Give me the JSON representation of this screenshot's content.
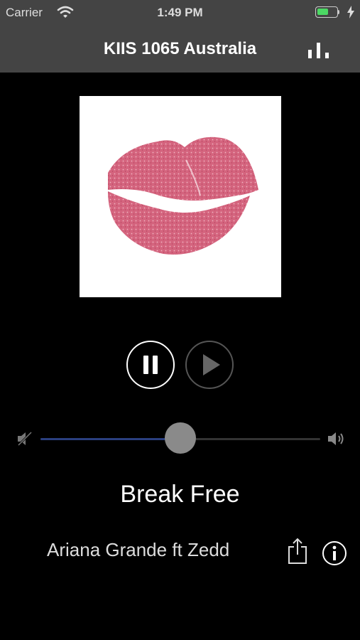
{
  "status_bar": {
    "carrier": "Carrier",
    "time": "1:49 PM",
    "battery_level": 0.6,
    "battery_color": "#4cd964"
  },
  "nav": {
    "title": "KIIS 1065 Australia",
    "equalizer_icon": "equalizer-icon"
  },
  "player": {
    "artwork_icon": "lips-icon",
    "pause_icon": "pause-icon",
    "play_icon": "play-icon",
    "volume_level": 0.5,
    "volume_fill_color": "#2a3f7f"
  },
  "track": {
    "title": "Break Free",
    "artist": "Ariana Grande ft Zedd"
  },
  "actions": {
    "share_icon": "share-icon",
    "info_icon": "info-icon"
  }
}
